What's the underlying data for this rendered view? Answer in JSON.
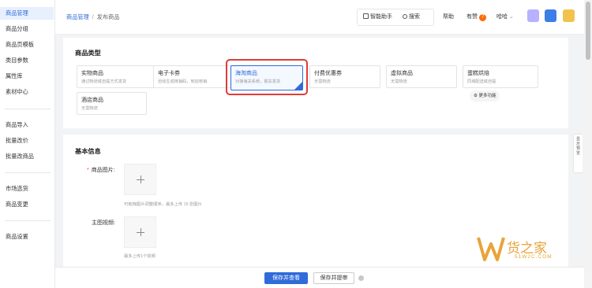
{
  "sidebar": {
    "items": [
      {
        "label": "商品管理",
        "active": true
      },
      {
        "label": "商品分组"
      },
      {
        "label": "商品页模板"
      },
      {
        "label": "类目参数"
      },
      {
        "label": "属性库"
      },
      {
        "label": "素材中心"
      },
      {
        "label": "商品导入"
      },
      {
        "label": "批量改价"
      },
      {
        "label": "批量改商品"
      },
      {
        "label": "市场选货"
      },
      {
        "label": "商品变更"
      },
      {
        "label": "商品设置"
      }
    ]
  },
  "header": {
    "breadcrumb": {
      "root": "商品管理",
      "separator": "/",
      "current": "发布商品"
    },
    "assistant": "智能助手",
    "search": "搜索",
    "help": "帮助",
    "notice": "有赞",
    "notice_count": "7",
    "user": "哈哈"
  },
  "goods_type": {
    "title": "商品类型",
    "cards": [
      {
        "title": "实物商品",
        "desc": "通过物流或自提方式发货"
      },
      {
        "title": "电子卡券",
        "desc": "自动生成核销码，到店核销"
      },
      {
        "title": "海淘商品",
        "desc": "对接海关系统，报关发货",
        "selected": true
      },
      {
        "title": "付费优惠券",
        "desc": "无需物流"
      },
      {
        "title": "虚拟商品",
        "desc": "无需物流"
      },
      {
        "title": "蛋糕烘焙",
        "desc": "同城配送或自提"
      },
      {
        "title": "酒店商品",
        "desc": "无需物流"
      }
    ],
    "more": "更多功能"
  },
  "basic_info": {
    "title": "基本信息",
    "image_label": "商品图片:",
    "image_hint": "可拖拽图片调整顺序，最多上传 15 张图片",
    "video_label": "主图视频:",
    "video_hint": "最多上传1个视频"
  },
  "footer": {
    "primary": "保存并查看",
    "secondary": "保存并提审"
  },
  "side_tab": "显示预览",
  "watermark": {
    "text": "货之家",
    "sub": "51W2C.COM"
  },
  "colors": {
    "accent": "#2f6bd9",
    "highlight": "#e03b3b",
    "badge": "#ff6a00"
  }
}
